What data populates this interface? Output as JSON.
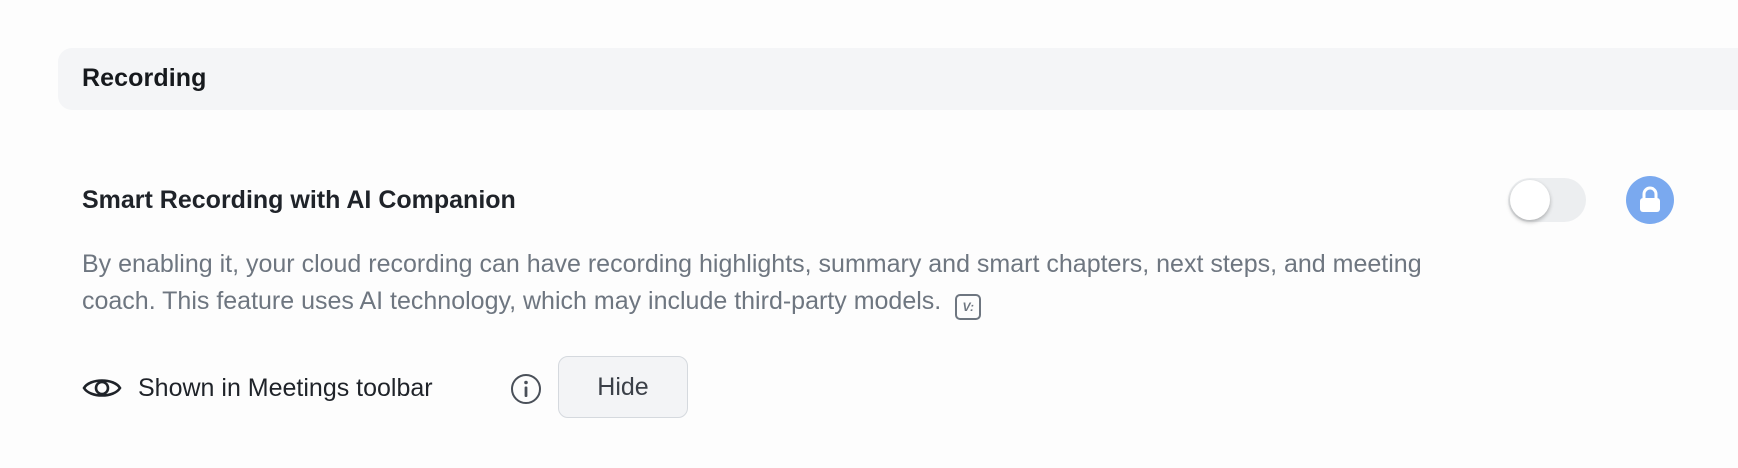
{
  "section": {
    "title": "Recording"
  },
  "setting": {
    "title": "Smart Recording with AI Companion",
    "description": "By enabling it, your cloud recording can have recording highlights, summary and smart chapters, next steps, and meeting coach. This feature uses AI technology, which may include third-party models.",
    "ai_badge_icon": "ai-badge-icon",
    "toggle_enabled": false,
    "lock_icon": "lock-icon",
    "colors": {
      "lock_bg": "#7aa9ef",
      "toggle_track": "#eceef0",
      "description_text": "#6e7680"
    }
  },
  "toolbar": {
    "eye_icon": "eye-icon",
    "label": "Shown in Meetings toolbar",
    "info_icon": "info-icon",
    "hide_button_label": "Hide"
  }
}
